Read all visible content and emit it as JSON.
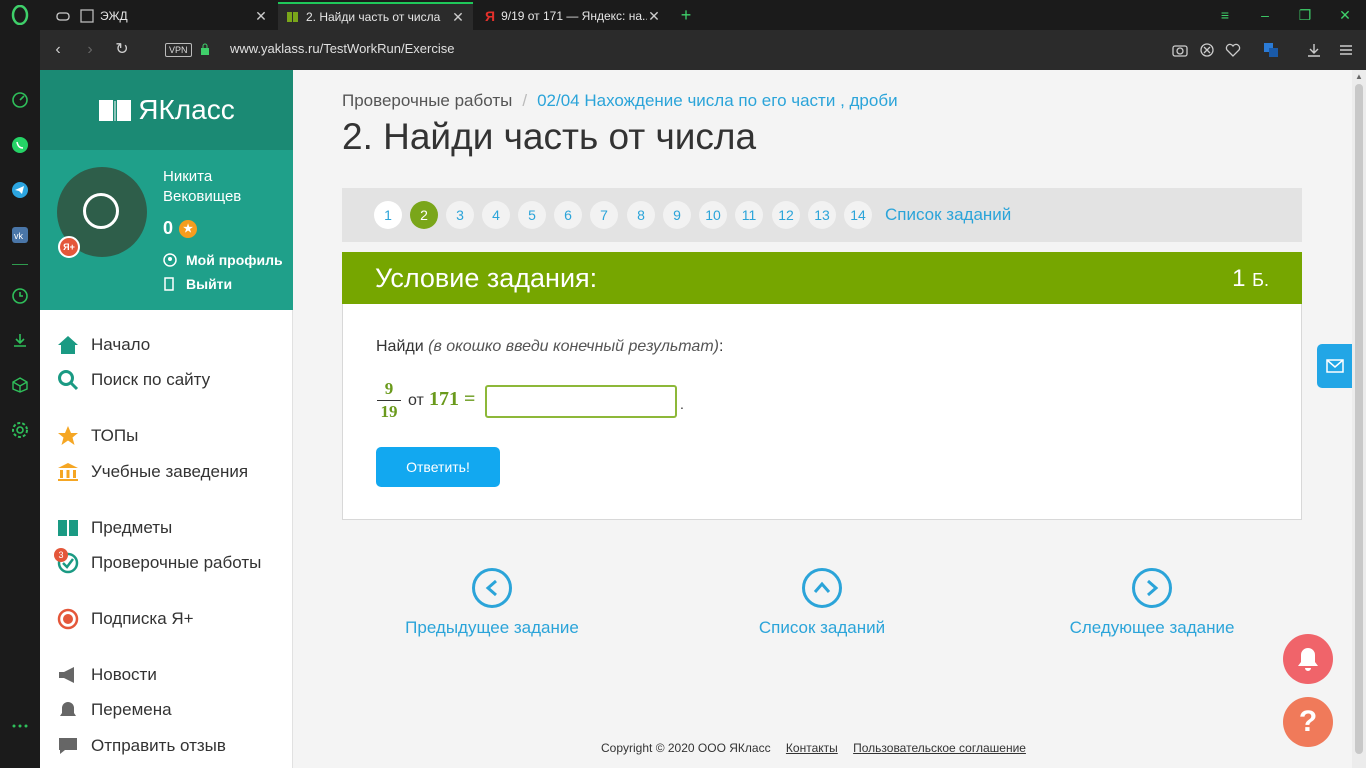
{
  "browser": {
    "tabs": [
      {
        "label": "ЭЖД"
      },
      {
        "label": "2. Найди часть от числа"
      },
      {
        "label": "9/19 от 171 — Яндекс: на..."
      }
    ],
    "url": "www.yaklass.ru/TestWorkRun/Exercise",
    "vpn_label": "VPN"
  },
  "sidebar": {
    "logo": "ЯКласс",
    "user": {
      "name": "Никита Вековищев",
      "points": "0",
      "ya_badge": "Я+"
    },
    "profile_link": "Мой профиль",
    "logout_link": "Выйти",
    "menu": [
      {
        "label": "Начало"
      },
      {
        "label": "Поиск по сайту"
      },
      {
        "label": "ТОПы"
      },
      {
        "label": "Учебные заведения"
      },
      {
        "label": "Предметы"
      },
      {
        "label": "Проверочные работы"
      },
      {
        "label": "Подписка Я+"
      },
      {
        "label": "Новости"
      },
      {
        "label": "Перемена"
      },
      {
        "label": "Отправить отзыв"
      }
    ],
    "tests_badge": "3"
  },
  "breadcrumb": {
    "root": "Проверочные работы",
    "current": "02/04 Нахождение числа по его части , дроби"
  },
  "title": "2. Найди часть от числа",
  "pager": {
    "pages": [
      "1",
      "2",
      "3",
      "4",
      "5",
      "6",
      "7",
      "8",
      "9",
      "10",
      "11",
      "12",
      "13",
      "14"
    ],
    "current": "2",
    "list_link": "Список заданий"
  },
  "task": {
    "header": "Условие задания:",
    "points": "1",
    "points_unit": "Б.",
    "instruction_prefix": "Найди ",
    "instruction_italic": "(в окошко введи конечный результат)",
    "instruction_suffix": ":",
    "numerator": "9",
    "denominator": "19",
    "of": "от",
    "number": "171 =",
    "answer_value": "",
    "dot": ".",
    "submit": "Ответить!"
  },
  "nav": {
    "prev": "Предыдущее задание",
    "list": "Список заданий",
    "next": "Следующее задание"
  },
  "footer": {
    "copyright": "Copyright © 2020 ООО ЯКласс",
    "contacts": "Контакты",
    "agreement": "Пользовательское соглашение"
  }
}
